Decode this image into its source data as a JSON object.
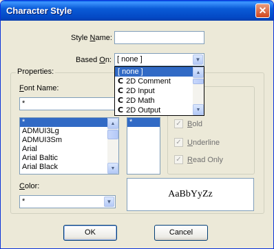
{
  "window": {
    "title": "Character Style",
    "close_glyph": "✕"
  },
  "style_name": {
    "label_prefix": "Style ",
    "label_underlined": "N",
    "label_suffix": "ame:",
    "value": ""
  },
  "based_on": {
    "label_prefix": "Based ",
    "label_underlined": "O",
    "label_suffix": "n:",
    "value": "[ none ]",
    "options": [
      {
        "label": "[ none ]",
        "icon": "",
        "selected": true
      },
      {
        "label": "2D Comment",
        "icon": "C",
        "selected": false
      },
      {
        "label": "2D Input",
        "icon": "C",
        "selected": false
      },
      {
        "label": "2D Math",
        "icon": "C",
        "selected": false
      },
      {
        "label": "2D Output",
        "icon": "C",
        "selected": false
      }
    ]
  },
  "properties": {
    "group_label": "Properties:",
    "font_name": {
      "label_underlined": "F",
      "label_suffix": "ont Name:",
      "value": "*",
      "list": [
        "*",
        "ADMUI3Lg",
        "ADMUI3Sm",
        "Arial",
        "Arial Baltic",
        "Arial Black"
      ],
      "selected_index": 0
    },
    "size_list": {
      "items": [
        "*"
      ],
      "selected_index": 0
    },
    "attributes": {
      "bold": {
        "label": "Bold",
        "underlined": "B",
        "rest": "old",
        "checked": true
      },
      "underline": {
        "label": "Underline",
        "underlined": "U",
        "rest": "nderline",
        "checked": true
      },
      "read_only": {
        "label": "Read Only",
        "underlined": "R",
        "rest": "ead Only",
        "checked": true
      }
    },
    "color": {
      "label_underlined": "C",
      "label_suffix": "olor:",
      "value": "*"
    },
    "preview_text": "AaBbYyZz"
  },
  "buttons": {
    "ok": "OK",
    "cancel": "Cancel"
  },
  "icons": {
    "combo_arrow": "chevron-down-icon",
    "scroll_up": "scroll-up-icon",
    "scroll_down": "scroll-down-icon",
    "check": "checkmark-icon"
  },
  "colors": {
    "selection": "#316ac5",
    "titlebar": "#0a5bd7",
    "dialog_bg": "#ece9d8"
  }
}
